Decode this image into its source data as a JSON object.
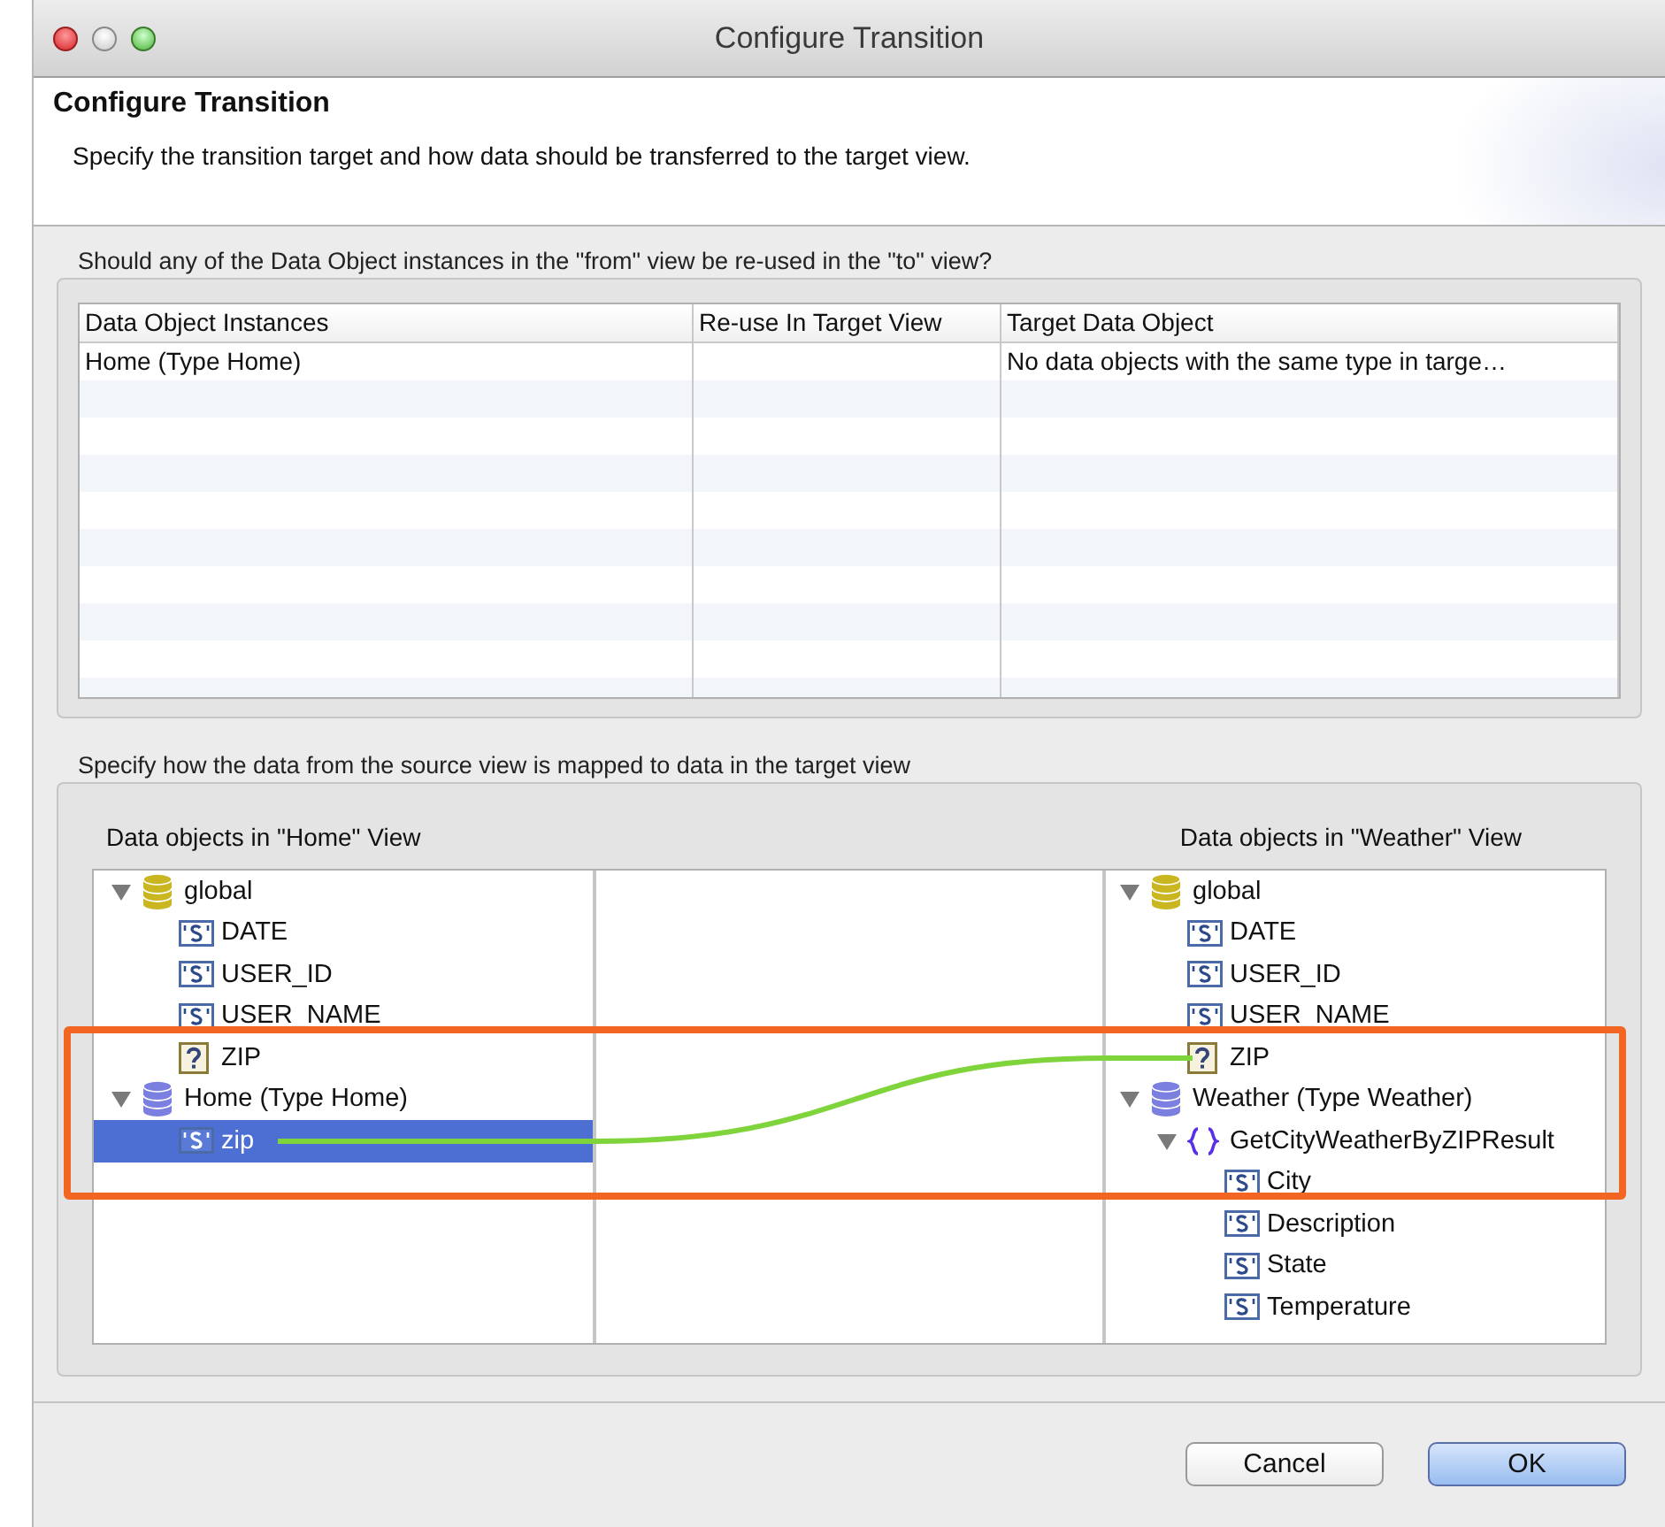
{
  "window": {
    "title": "Configure Transition"
  },
  "header": {
    "title": "Configure Transition",
    "description": "Specify the transition target and how data should be transferred to the target view."
  },
  "reuse_section": {
    "label": "Should any of the Data Object instances in the \"from\" view be re-used in the \"to\" view?",
    "table": {
      "columns": [
        "Data Object Instances",
        "Re-use In Target View",
        "Target Data Object"
      ],
      "rows": [
        {
          "instance": "Home (Type Home)",
          "target": "No data objects with the same type in targe…"
        }
      ]
    }
  },
  "mapping_section": {
    "label": "Specify how the data from the source view is mapped to data in the target view",
    "source": {
      "heading": "Data objects in \"Home\" View",
      "items": [
        {
          "label": "global",
          "kind": "database",
          "color": "#c9b620",
          "expanded": true,
          "selected": false,
          "children": [
            {
              "label": "DATE",
              "kind": "string",
              "selected": false
            },
            {
              "label": "USER_ID",
              "kind": "string",
              "selected": false
            },
            {
              "label": "USER_NAME",
              "kind": "string",
              "selected": false
            },
            {
              "label": "ZIP",
              "kind": "unknown",
              "selected": false
            }
          ]
        },
        {
          "label": "Home (Type Home)",
          "kind": "database",
          "color": "#7b7fe0",
          "expanded": true,
          "selected": false,
          "children": [
            {
              "label": "zip",
              "kind": "string",
              "selected": true,
              "mapped": true
            }
          ]
        }
      ]
    },
    "target": {
      "heading": "Data objects in \"Weather\" View",
      "items": [
        {
          "label": "global",
          "kind": "database",
          "color": "#c9b620",
          "expanded": true,
          "selected": false,
          "children": [
            {
              "label": "DATE",
              "kind": "string",
              "selected": false
            },
            {
              "label": "USER_ID",
              "kind": "string",
              "selected": false
            },
            {
              "label": "USER_NAME",
              "kind": "string",
              "selected": false
            },
            {
              "label": "ZIP",
              "kind": "unknown",
              "selected": false,
              "mapped": true
            }
          ]
        },
        {
          "label": "Weather (Type Weather)",
          "kind": "database",
          "color": "#7b7fe0",
          "expanded": true,
          "selected": false,
          "children": [
            {
              "label": "GetCityWeatherByZIPResult",
              "kind": "object",
              "expanded": true,
              "selected": false,
              "children": [
                {
                  "label": "City",
                  "kind": "string",
                  "selected": false
                },
                {
                  "label": "Description",
                  "kind": "string",
                  "selected": false
                },
                {
                  "label": "State",
                  "kind": "string",
                  "selected": false
                },
                {
                  "label": "Temperature",
                  "kind": "string",
                  "selected": false
                }
              ]
            }
          ]
        }
      ]
    }
  },
  "buttons": [
    {
      "label": "Cancel",
      "default": false
    },
    {
      "label": "OK",
      "default": true
    }
  ],
  "annotation": {
    "kind": "highlight-frame"
  }
}
